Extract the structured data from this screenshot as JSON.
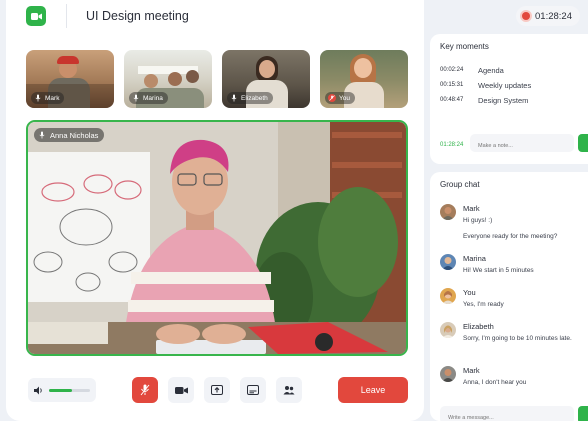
{
  "meeting": {
    "title": "UI Design meeting",
    "elapsed": "01:28:24"
  },
  "participants": [
    {
      "name": "Mark",
      "muted": true
    },
    {
      "name": "Marina",
      "muted": true
    },
    {
      "name": "Elizabeth",
      "muted": true
    },
    {
      "name": "You",
      "muted": true
    }
  ],
  "speaker": {
    "name": "Anna Nicholas"
  },
  "controls": {
    "volume_level": 0.55,
    "leave_label": "Leave"
  },
  "key_moments": {
    "title": "Key moments",
    "items": [
      {
        "time": "00:02:24",
        "label": "Agenda"
      },
      {
        "time": "00:15:31",
        "label": "Weekly updates"
      },
      {
        "time": "00:48:47",
        "label": "Design System"
      }
    ],
    "current_time": "01:28:24",
    "note_placeholder": "Make a note..."
  },
  "chat": {
    "title": "Group chat",
    "messages": [
      {
        "name": "Mark",
        "lines": [
          "Hi guys! :)",
          "Everyone ready for the meeting?"
        ]
      },
      {
        "name": "Marina",
        "lines": [
          "Hi! We start in 5 minutes"
        ]
      },
      {
        "name": "You",
        "lines": [
          "Yes, I'm ready"
        ]
      },
      {
        "name": "Elizabeth",
        "lines": [
          "Sorry, I'm going to be 10 minutes late."
        ]
      },
      {
        "name": "Mark",
        "lines": [
          "Anna, I don't hear you"
        ]
      }
    ],
    "message_placeholder": "Write a message..."
  },
  "colors": {
    "accent": "#2fb34a",
    "danger": "#e2483d",
    "background": "#eef1f6"
  },
  "icons": [
    "video-camera-icon",
    "record-icon",
    "mic-muted-icon",
    "volume-icon",
    "camera-icon",
    "share-screen-icon",
    "captions-icon",
    "people-icon",
    "send-icon"
  ]
}
